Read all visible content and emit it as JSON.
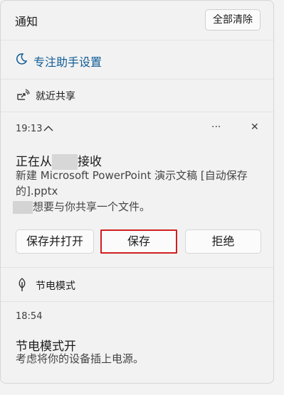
{
  "header": {
    "title": "通知",
    "clear_all_label": "全部清除"
  },
  "focus_assist": {
    "label": "专注助手设置"
  },
  "nearby_sharing": {
    "section_title": "就近共享",
    "time": "19:13",
    "more_glyph": "···",
    "close_glyph": "✕",
    "notif_title_prefix": "正在从",
    "notif_title_suffix": "接收",
    "body_line1": "新建 Microsoft PowerPoint 演示文稿 [自动保存",
    "body_line2": "的].pptx",
    "body_line3_suffix": "想要与你共享一个文件。",
    "buttons": {
      "save_open": "保存并打开",
      "save": "保存",
      "decline": "拒绝"
    },
    "icon": "share-wireless-icon"
  },
  "battery_saver": {
    "section_title": "节电模式",
    "time": "18:54",
    "notif_title": "节电模式开",
    "body": "考虑将你的设备插上电源。",
    "icon": "leaf-icon"
  },
  "colors": {
    "accent": "#0f5c96",
    "highlight_border": "#d11f1f"
  }
}
